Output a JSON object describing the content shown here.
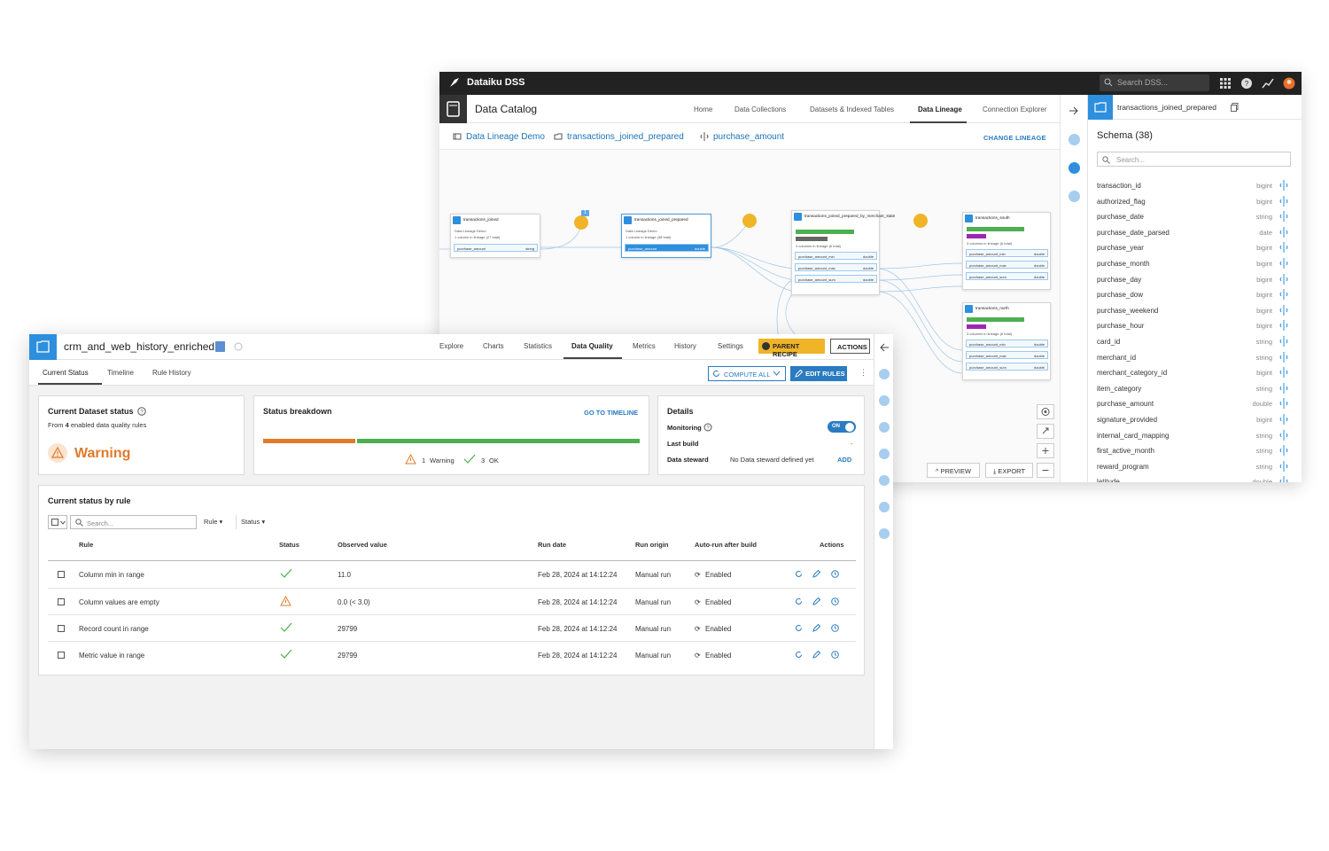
{
  "back_window": {
    "brand": "Dataiku DSS",
    "search_placeholder": "Search DSS...",
    "catalog_title": "Data Catalog",
    "nav": [
      "Home",
      "Data Collections",
      "Datasets & Indexed Tables",
      "Data Lineage",
      "Connection Explorer"
    ],
    "breadcrumbs": [
      "Data Lineage Demo",
      "transactions_joined_prepared",
      "purchase_amount"
    ],
    "change_lineage": "CHANGE LINEAGE",
    "graph": {
      "node1": {
        "title": "transactions_joined",
        "sub1": "Data Lineage Demo",
        "sub2": "1 column in lineage (27 total)",
        "row": "purchase_amount",
        "type": "string"
      },
      "node2": {
        "title": "transactions_joined_prepared",
        "sub1": "Data Lineage Demo",
        "sub2": "1 column in lineage (38 total)",
        "row": "purchase_amount",
        "type": "double"
      },
      "node3": {
        "title": "transactions_joined_prepared_by_merchant_state",
        "sub2": "3 columns in lineage (6 total)",
        "rows": [
          "purchase_amount_min",
          "purchase_amount_max",
          "purchase_amount_sum"
        ],
        "type": "double"
      },
      "node4": {
        "title": "transactions_south",
        "sub2": "3 columns in lineage (6 total)",
        "rows": [
          "purchase_amount_min",
          "purchase_amount_max",
          "purchase_amount_sum"
        ],
        "type": "double"
      },
      "node5": {
        "title": "transactions_north",
        "sub2": "3 columns in lineage (6 total)",
        "rows": [
          "purchase_amount_min",
          "purchase_amount_max",
          "purchase_amount_sum"
        ],
        "type": "double"
      },
      "recipe_badge": "1"
    },
    "preview_btn": "PREVIEW",
    "export_btn": "EXPORT",
    "panel": {
      "dataset": "transactions_joined_prepared",
      "schema_title": "Schema (38)",
      "search_placeholder": "Search...",
      "columns": [
        {
          "name": "transaction_id",
          "type": "bigint"
        },
        {
          "name": "authorized_flag",
          "type": "bigint"
        },
        {
          "name": "purchase_date",
          "type": "string"
        },
        {
          "name": "purchase_date_parsed",
          "type": "date"
        },
        {
          "name": "purchase_year",
          "type": "bigint"
        },
        {
          "name": "purchase_month",
          "type": "bigint"
        },
        {
          "name": "purchase_day",
          "type": "bigint"
        },
        {
          "name": "purchase_dow",
          "type": "bigint"
        },
        {
          "name": "purchase_weekend",
          "type": "bigint"
        },
        {
          "name": "purchase_hour",
          "type": "bigint"
        },
        {
          "name": "card_id",
          "type": "string"
        },
        {
          "name": "merchant_id",
          "type": "string"
        },
        {
          "name": "merchant_category_id",
          "type": "bigint"
        },
        {
          "name": "item_category",
          "type": "string"
        },
        {
          "name": "purchase_amount",
          "type": "double"
        },
        {
          "name": "signature_provided",
          "type": "bigint"
        },
        {
          "name": "internal_card_mapping",
          "type": "string"
        },
        {
          "name": "first_active_month",
          "type": "string"
        },
        {
          "name": "reward_program",
          "type": "string"
        },
        {
          "name": "latitude",
          "type": "double"
        }
      ]
    }
  },
  "front_window": {
    "dataset_name": "crm_and_web_history_enriched",
    "tabs": [
      "Explore",
      "Charts",
      "Statistics",
      "Data Quality",
      "Metrics",
      "History",
      "Settings"
    ],
    "parent_recipe": "PARENT RECIPE",
    "actions": "ACTIONS",
    "subtabs": [
      "Current Status",
      "Timeline",
      "Rule History"
    ],
    "compute_all": "COMPUTE ALL",
    "edit_rules": "EDIT RULES",
    "dataset_status": {
      "title": "Current Dataset status",
      "from_prefix": "From ",
      "count": "4",
      "from_suffix": " enabled data quality rules",
      "status": "Warning"
    },
    "breakdown": {
      "title": "Status breakdown",
      "go_timeline": "GO TO TIMELINE",
      "warning_count": "1",
      "warning_label": "Warning",
      "ok_count": "3",
      "ok_label": "OK",
      "warning_fraction": 0.25
    },
    "details": {
      "title": "Details",
      "monitoring_label": "Monitoring",
      "monitoring_state": "ON",
      "last_build_label": "Last build",
      "last_build_value": "-",
      "steward_label": "Data steward",
      "steward_value": "No Data steward defined yet",
      "add": "ADD"
    },
    "rules": {
      "title": "Current status by rule",
      "search_placeholder": "Search...",
      "filter_rule": "Rule",
      "filter_status": "Status",
      "headers": [
        "Rule",
        "Status",
        "Observed value",
        "Run date",
        "Run origin",
        "Auto-run after build",
        "Actions"
      ],
      "rows": [
        {
          "rule": "Column min in range",
          "status": "ok",
          "observed": "11.0",
          "date": "Feb 28, 2024 at 14:12:24",
          "origin": "Manual run",
          "autorun": "Enabled"
        },
        {
          "rule": "Column values are empty",
          "status": "warning",
          "observed": "0.0 (< 3.0)",
          "date": "Feb 28, 2024 at 14:12:24",
          "origin": "Manual run",
          "autorun": "Enabled"
        },
        {
          "rule": "Record count in range",
          "status": "ok",
          "observed": "29799",
          "date": "Feb 28, 2024 at 14:12:24",
          "origin": "Manual run",
          "autorun": "Enabled"
        },
        {
          "rule": "Metric value in range",
          "status": "ok",
          "observed": "29799",
          "date": "Feb 28, 2024 at 14:12:24",
          "origin": "Manual run",
          "autorun": "Enabled"
        }
      ]
    }
  },
  "colors": {
    "accent_blue": "#2d8fdd",
    "warning_orange": "#e07b2a",
    "ok_green": "#4caf50",
    "parent_recipe_yellow": "#f0b429",
    "topbar_dark": "#222222"
  }
}
